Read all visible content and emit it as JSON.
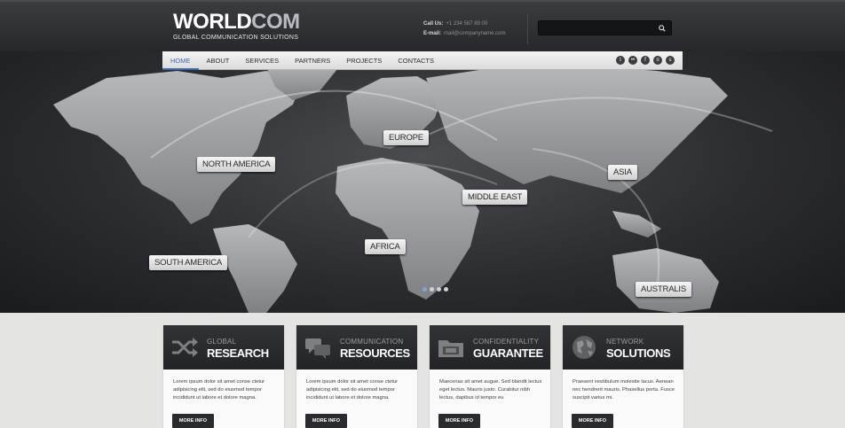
{
  "brand": {
    "name_part1": "WORLD",
    "name_part2": "COM",
    "tagline": "GLOBAL COMMUNICATION SOLUTIONS"
  },
  "contact": {
    "call_label": "Call Us:",
    "call_value": "+1 234 567 89 00",
    "email_label": "E-mail:",
    "email_value": "mail@companyname.com"
  },
  "search": {
    "placeholder": "",
    "icon": "search-icon"
  },
  "nav": {
    "items": [
      "HOME",
      "ABOUT",
      "SERVICES",
      "PARTNERS",
      "PROJECTS",
      "CONTACTS"
    ],
    "active_index": 0
  },
  "social": [
    "twitter-icon",
    "flickr-icon",
    "facebook-icon",
    "rss-icon",
    "skype-icon"
  ],
  "hero": {
    "regions": [
      "NORTH AMERICA",
      "EUROPE",
      "ASIA",
      "MIDDLE EAST",
      "AFRICA",
      "SOUTH AMERICA",
      "AUSTRALIS"
    ],
    "slides_total": 4,
    "slide_active": 1
  },
  "features": [
    {
      "subtitle": "GLOBAL",
      "title": "RESEARCH",
      "icon": "shuffle-icon",
      "text": "Lorem ipsum dolor sit amet conse ctetur adipisicing elit, sed do eiusmod tempor incididunt ut labore et dolore magna.",
      "button": "MORE INFO"
    },
    {
      "subtitle": "COMMUNICATION",
      "title": "RESOURCES",
      "icon": "chat-icon",
      "text": "Lorem ipsum dolor sit amet conse ctetur adipisicing elit, sed do eiusmod tempor incididunt ut labore et dolore magna.",
      "button": "MORE INFO"
    },
    {
      "subtitle": "CONFIDENTIALITY",
      "title": "GUARANTEE",
      "icon": "folder-icon",
      "text": "Maecenas sit amet augue. Sed blandit lectus eget lectus. Mauris justo. Curabitur nibh lectus, dapibus id tempor eu",
      "button": "MORE INFO"
    },
    {
      "subtitle": "NETWORK",
      "title": "SOLUTIONS",
      "icon": "globe-icon",
      "text": "Praesent vestibulum molestie lacus. Aenean nec hendrerit mauris. Phasellus porta. Fusce suscipit varius mi.",
      "button": "MORE INFO"
    }
  ],
  "colors": {
    "accent": "#3a6bb5",
    "header_dark": "#26282b",
    "body_bg": "#e4e4e2"
  }
}
